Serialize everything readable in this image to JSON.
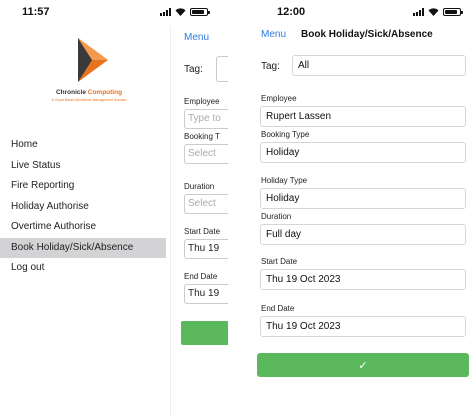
{
  "left": {
    "time": "11:57",
    "logo": {
      "name_part1": "Chronicle",
      "name_part2": "Computing",
      "tagline": "A Cloud Based Workforce Management Solution",
      "colors": {
        "orange": "#e8731e",
        "dark": "#3a3a3a"
      }
    },
    "menu": [
      {
        "label": "Home"
      },
      {
        "label": "Live Status"
      },
      {
        "label": "Fire Reporting"
      },
      {
        "label": "Holiday Authorise"
      },
      {
        "label": "Overtime Authorise"
      },
      {
        "label": "Book Holiday/Sick/Absence",
        "active": true
      },
      {
        "label": "Log out"
      }
    ],
    "peek": {
      "menu_label": "Menu",
      "tag_label": "Tag:",
      "employee_label": "Employee",
      "employee_placeholder": "Type to",
      "booking_type_label": "Booking T",
      "booking_type_placeholder": "Select",
      "duration_label": "Duration",
      "duration_placeholder": "Select",
      "start_date_label": "Start Date",
      "start_date_value": "Thu 19",
      "end_date_label": "End Date",
      "end_date_value": "Thu 19"
    }
  },
  "right": {
    "time": "12:00",
    "nav": {
      "menu_label": "Menu",
      "title": "Book Holiday/Sick/Absence"
    },
    "form": {
      "tag_label": "Tag:",
      "tag_value": "All",
      "employee_label": "Employee",
      "employee_value": "Rupert Lassen",
      "booking_type_label": "Booking Type",
      "booking_type_value": "Holiday",
      "holiday_type_label": "Holiday Type",
      "holiday_type_value": "Holiday",
      "duration_label": "Duration",
      "duration_value": "Full day",
      "start_date_label": "Start Date",
      "start_date_value": "Thu 19 Oct 2023",
      "end_date_label": "End Date",
      "end_date_value": "Thu 19 Oct 2023",
      "submit_icon": "checkmark-icon"
    }
  },
  "colors": {
    "accent": "#2a7ae4",
    "success": "#5cb85c",
    "active_bg": "#d3d3d5"
  }
}
